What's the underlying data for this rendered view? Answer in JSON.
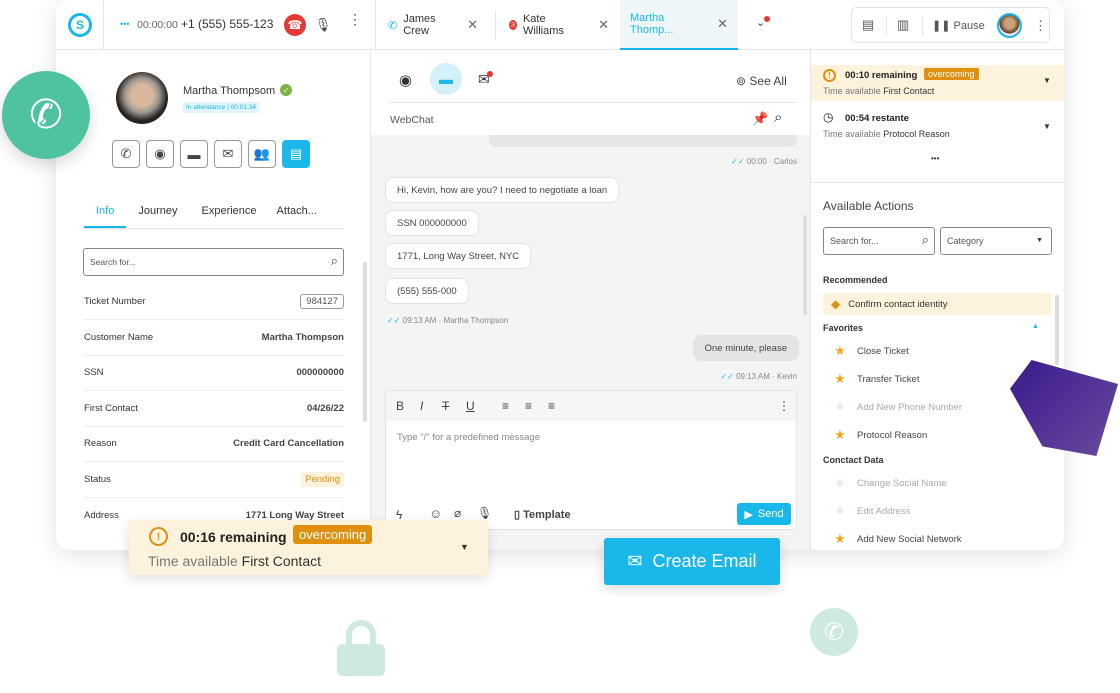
{
  "topbar": {
    "call_status": "•••",
    "call_timer": "00:00:00",
    "phone": "+1 (555) 555-123",
    "tabs": [
      {
        "label": "James Crew",
        "icon": "phone-ringing-icon"
      },
      {
        "label": "Kate Williams",
        "badge": "3"
      },
      {
        "label": "Martha Thomp...",
        "active": true
      }
    ],
    "pause_label": "Pause"
  },
  "contact": {
    "name": "Martha Thompsom",
    "status": "In attendance | 00:01:34",
    "tabs": [
      "Info",
      "Journey",
      "Experience",
      "Attach..."
    ],
    "active_tab": "Info",
    "search_placeholder": "Search for...",
    "fields": [
      {
        "label": "Ticket Number",
        "value": "984127"
      },
      {
        "label": "Customer Name",
        "value": "Martha Thompson"
      },
      {
        "label": "SSN",
        "value": "000000000"
      },
      {
        "label": "First Contact",
        "value": "04/26/22"
      },
      {
        "label": "Reason",
        "value": "Credit Card Cancellation"
      },
      {
        "label": "Status",
        "value": "Pending"
      },
      {
        "label": "Address",
        "value": "1771 Long Way Street"
      }
    ]
  },
  "chat": {
    "see_all": "See All",
    "channel": "WebChat",
    "meta_top": "00:00 · Carlos",
    "incoming": [
      "Hi, Kevin, how are you? I need to negotiate a loan",
      "SSN 000000000",
      "1771, Long Way Street, NYC",
      "(555) 555-000"
    ],
    "incoming_meta": "09:13 AM · Martha Thompson",
    "outgoing": "One minute, please",
    "outgoing_meta": "09:13 AM · Kevin",
    "editor_placeholder": "Type \"/\" for a predefined message",
    "template_label": "Template",
    "send_label": "Send"
  },
  "sla": [
    {
      "time": "00:10 remaining",
      "badge": "overcoming",
      "label": "Time available",
      "target": "First Contact"
    },
    {
      "time": "00:54 restante",
      "label": "Time available",
      "target": "Protocol Reason"
    }
  ],
  "sla_more": "•••",
  "actions": {
    "title": "Available Actions",
    "search_placeholder": "Search for...",
    "category": "Category",
    "recommended_title": "Recommended",
    "recommended": "Confirm contact identity",
    "favorites_title": "Favorites",
    "favorites": [
      {
        "label": "Close Ticket",
        "starred": true
      },
      {
        "label": "Transfer Ticket",
        "starred": true
      },
      {
        "label": "Add New Phone Number",
        "starred": false
      },
      {
        "label": "Protocol Reason",
        "starred": true
      }
    ],
    "contact_title": "Conctact Data",
    "contact": [
      {
        "label": "Change Social Name",
        "starred": false
      },
      {
        "label": "Edit Address",
        "starred": false
      },
      {
        "label": "Add New Social Network",
        "starred": true
      }
    ]
  },
  "overlay": {
    "time": "00:16 remaining",
    "badge": "overcoming",
    "label": "Time available",
    "target": "First Contact",
    "email_button": "Create Email"
  },
  "colors": {
    "accent": "#1ab7ea",
    "warning": "#e0900f",
    "warning_bg": "#fdf3dc",
    "hangup": "#e53935",
    "phone_bubble": "#4fc3a1"
  }
}
